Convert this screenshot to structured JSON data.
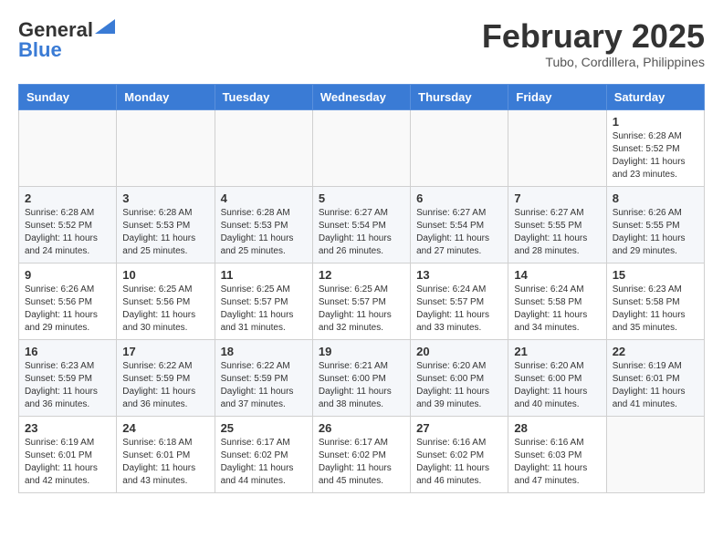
{
  "header": {
    "logo_general": "General",
    "logo_blue": "Blue",
    "month": "February 2025",
    "location": "Tubo, Cordillera, Philippines"
  },
  "days_of_week": [
    "Sunday",
    "Monday",
    "Tuesday",
    "Wednesday",
    "Thursday",
    "Friday",
    "Saturday"
  ],
  "weeks": [
    [
      {
        "day": "",
        "info": ""
      },
      {
        "day": "",
        "info": ""
      },
      {
        "day": "",
        "info": ""
      },
      {
        "day": "",
        "info": ""
      },
      {
        "day": "",
        "info": ""
      },
      {
        "day": "",
        "info": ""
      },
      {
        "day": "1",
        "info": "Sunrise: 6:28 AM\nSunset: 5:52 PM\nDaylight: 11 hours and 23 minutes."
      }
    ],
    [
      {
        "day": "2",
        "info": "Sunrise: 6:28 AM\nSunset: 5:52 PM\nDaylight: 11 hours and 24 minutes."
      },
      {
        "day": "3",
        "info": "Sunrise: 6:28 AM\nSunset: 5:53 PM\nDaylight: 11 hours and 25 minutes."
      },
      {
        "day": "4",
        "info": "Sunrise: 6:28 AM\nSunset: 5:53 PM\nDaylight: 11 hours and 25 minutes."
      },
      {
        "day": "5",
        "info": "Sunrise: 6:27 AM\nSunset: 5:54 PM\nDaylight: 11 hours and 26 minutes."
      },
      {
        "day": "6",
        "info": "Sunrise: 6:27 AM\nSunset: 5:54 PM\nDaylight: 11 hours and 27 minutes."
      },
      {
        "day": "7",
        "info": "Sunrise: 6:27 AM\nSunset: 5:55 PM\nDaylight: 11 hours and 28 minutes."
      },
      {
        "day": "8",
        "info": "Sunrise: 6:26 AM\nSunset: 5:55 PM\nDaylight: 11 hours and 29 minutes."
      }
    ],
    [
      {
        "day": "9",
        "info": "Sunrise: 6:26 AM\nSunset: 5:56 PM\nDaylight: 11 hours and 29 minutes."
      },
      {
        "day": "10",
        "info": "Sunrise: 6:25 AM\nSunset: 5:56 PM\nDaylight: 11 hours and 30 minutes."
      },
      {
        "day": "11",
        "info": "Sunrise: 6:25 AM\nSunset: 5:57 PM\nDaylight: 11 hours and 31 minutes."
      },
      {
        "day": "12",
        "info": "Sunrise: 6:25 AM\nSunset: 5:57 PM\nDaylight: 11 hours and 32 minutes."
      },
      {
        "day": "13",
        "info": "Sunrise: 6:24 AM\nSunset: 5:57 PM\nDaylight: 11 hours and 33 minutes."
      },
      {
        "day": "14",
        "info": "Sunrise: 6:24 AM\nSunset: 5:58 PM\nDaylight: 11 hours and 34 minutes."
      },
      {
        "day": "15",
        "info": "Sunrise: 6:23 AM\nSunset: 5:58 PM\nDaylight: 11 hours and 35 minutes."
      }
    ],
    [
      {
        "day": "16",
        "info": "Sunrise: 6:23 AM\nSunset: 5:59 PM\nDaylight: 11 hours and 36 minutes."
      },
      {
        "day": "17",
        "info": "Sunrise: 6:22 AM\nSunset: 5:59 PM\nDaylight: 11 hours and 36 minutes."
      },
      {
        "day": "18",
        "info": "Sunrise: 6:22 AM\nSunset: 5:59 PM\nDaylight: 11 hours and 37 minutes."
      },
      {
        "day": "19",
        "info": "Sunrise: 6:21 AM\nSunset: 6:00 PM\nDaylight: 11 hours and 38 minutes."
      },
      {
        "day": "20",
        "info": "Sunrise: 6:20 AM\nSunset: 6:00 PM\nDaylight: 11 hours and 39 minutes."
      },
      {
        "day": "21",
        "info": "Sunrise: 6:20 AM\nSunset: 6:00 PM\nDaylight: 11 hours and 40 minutes."
      },
      {
        "day": "22",
        "info": "Sunrise: 6:19 AM\nSunset: 6:01 PM\nDaylight: 11 hours and 41 minutes."
      }
    ],
    [
      {
        "day": "23",
        "info": "Sunrise: 6:19 AM\nSunset: 6:01 PM\nDaylight: 11 hours and 42 minutes."
      },
      {
        "day": "24",
        "info": "Sunrise: 6:18 AM\nSunset: 6:01 PM\nDaylight: 11 hours and 43 minutes."
      },
      {
        "day": "25",
        "info": "Sunrise: 6:17 AM\nSunset: 6:02 PM\nDaylight: 11 hours and 44 minutes."
      },
      {
        "day": "26",
        "info": "Sunrise: 6:17 AM\nSunset: 6:02 PM\nDaylight: 11 hours and 45 minutes."
      },
      {
        "day": "27",
        "info": "Sunrise: 6:16 AM\nSunset: 6:02 PM\nDaylight: 11 hours and 46 minutes."
      },
      {
        "day": "28",
        "info": "Sunrise: 6:16 AM\nSunset: 6:03 PM\nDaylight: 11 hours and 47 minutes."
      },
      {
        "day": "",
        "info": ""
      }
    ]
  ]
}
